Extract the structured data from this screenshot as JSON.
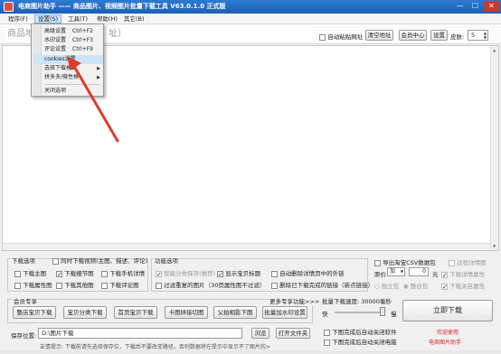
{
  "window": {
    "title": "电商图片助手 —— 商品图片、视频图片批量下载工具 V63.0.1.0 正式版",
    "controls": [
      "—",
      "☐",
      "✕"
    ]
  },
  "menu": {
    "items": [
      "程序(F)",
      "设置(S)",
      "工具(T)",
      "帮助(H)",
      "其它(B)"
    ]
  },
  "toolbar": {
    "url_placeholder": "商品地",
    "url_suffix": "址）",
    "auto_paste_label": "自动粘贴网址",
    "clear_label": "清空地址",
    "member_center": "会员中心",
    "settings": "设置",
    "threads_label": "皮肤:",
    "threads_value": "5"
  },
  "settings_menu": {
    "items": [
      {
        "label": "高级设置",
        "shortcut": "Ctrl+F2"
      },
      {
        "label": "水印设置",
        "shortcut": "Ctrl+F3"
      },
      {
        "label": "评论设置",
        "shortcut": "Ctrl+F9"
      },
      {
        "label": "cookies设置",
        "shortcut": ""
      },
      {
        "label": "选择下载模式",
        "shortcut": ""
      },
      {
        "label": "拼多多/微性格",
        "shortcut": ""
      },
      {
        "label": "关闭选项",
        "shortcut": ""
      }
    ]
  },
  "download_options": {
    "title": "下载选项",
    "items": [
      {
        "label": "下载主图",
        "checked": false
      },
      {
        "label": "下载细节图",
        "checked": true
      },
      {
        "label": "下载手机详情",
        "checked": false
      },
      {
        "label": "下载属性图",
        "checked": false
      },
      {
        "label": "下载其他图",
        "checked": false
      },
      {
        "label": "下载评论图",
        "checked": false
      }
    ],
    "video_label": "同时下载视频(主图、描述、评论)"
  },
  "function_options": {
    "title": "功能选项",
    "items": [
      {
        "label": "智能分类保存(推荐)",
        "checked": true,
        "disabled": true
      },
      {
        "label": "显示宝贝标题",
        "checked": true
      },
      {
        "label": "自动删除详情页中的外链",
        "checked": false
      },
      {
        "label": "过滤重复的图片（30页属性图不过滤）",
        "checked": false
      },
      {
        "label": "删除已下载完成的链接（新点链接）",
        "checked": false
      }
    ]
  },
  "right_options": {
    "export_label": "导出淘宝CSV数据包",
    "remote_detail": "远程详情图",
    "price_label": "原价",
    "price_mode": "加",
    "price_value": "0",
    "price_unit": "元",
    "download_detail_attr": "下载详情属性",
    "independent": "独立包",
    "merge": "整合包",
    "download_auto_attr": "下载关自属性"
  },
  "member": {
    "title": "会员专享",
    "more": "更多专享功能>>>",
    "buttons": [
      "整店宝贝下载",
      "宝贝分类下载",
      "首页宝贝下载",
      "卡图拼接切图",
      "父拍相影下图",
      "批量加水印设置"
    ]
  },
  "batch": {
    "speed_label": "批量下载速度: 30000毫秒",
    "fast": "快",
    "slow": "慢",
    "auto_close_software": "下图完成后自动关闭软件",
    "auto_shutdown": "下图完成后自动关闭电脑"
  },
  "download_btn": "立即下载",
  "welcome": "欢迎使用",
  "app_name": "电商图片助手",
  "save": {
    "label": "保存位置:",
    "path": "D:\\图片下载",
    "browse": "浏览",
    "open": "打开文件夹"
  },
  "tip": "友情提示: 下载前请先选择保存位，下载后不要改变路径，否则数据将在提示中显示不了图片的>",
  "colors": {
    "title_bar": "#1b5fb5",
    "accent_red": "#e02020",
    "arrow": "#e03a2a"
  }
}
